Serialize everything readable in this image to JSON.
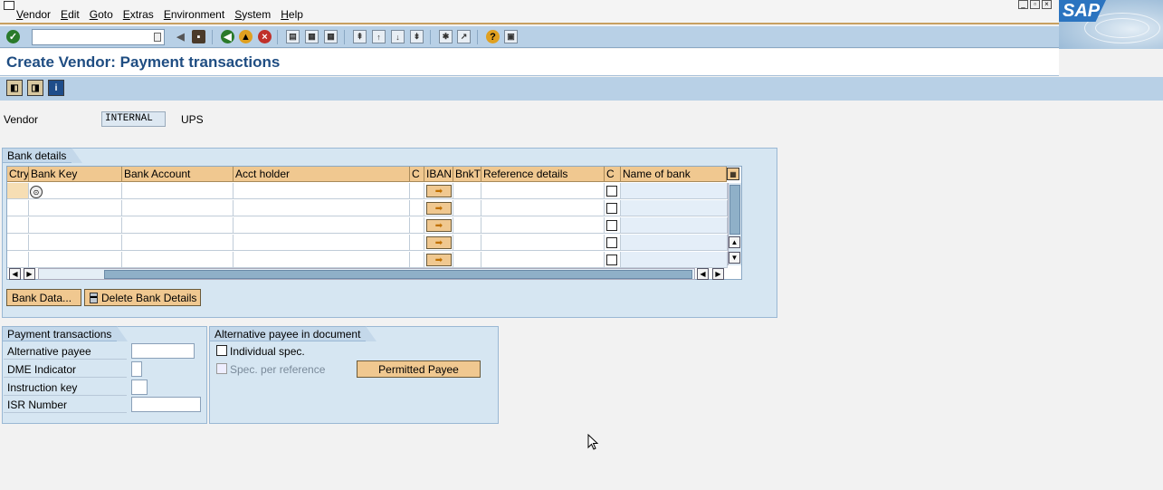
{
  "menu": {
    "items": [
      {
        "label": "Vendor",
        "u": "V",
        "rest": "endor"
      },
      {
        "label": "Edit",
        "u": "E",
        "rest": "dit"
      },
      {
        "label": "Goto",
        "u": "G",
        "rest": "oto"
      },
      {
        "label": "Extras",
        "u": "E",
        "rest": "xtras"
      },
      {
        "label": "Environment",
        "u": "E",
        "rest": "nvironment"
      },
      {
        "label": "System",
        "u": "S",
        "rest": "ystem"
      },
      {
        "label": "Help",
        "u": "H",
        "rest": "elp"
      }
    ]
  },
  "brand": {
    "logo_text": "SAP"
  },
  "command_field": {
    "value": ""
  },
  "title": "Create Vendor: Payment transactions",
  "vendor": {
    "label": "Vendor",
    "value": "INTERNAL",
    "name": "UPS"
  },
  "bank_details": {
    "title": "Bank details",
    "columns": [
      "Ctry",
      "Bank Key",
      "Bank Account",
      "Acct holder",
      "C",
      "IBAN",
      "BnkT",
      "Reference details",
      "C",
      "Name of bank"
    ],
    "rows": [
      [
        "",
        "",
        "",
        "",
        "",
        "",
        "",
        "",
        "",
        ""
      ],
      [
        "",
        "",
        "",
        "",
        "",
        "",
        "",
        "",
        "",
        ""
      ],
      [
        "",
        "",
        "",
        "",
        "",
        "",
        "",
        "",
        "",
        ""
      ],
      [
        "",
        "",
        "",
        "",
        "",
        "",
        "",
        "",
        "",
        ""
      ],
      [
        "",
        "",
        "",
        "",
        "",
        "",
        "",
        "",
        "",
        ""
      ]
    ],
    "buttons": {
      "bank_data": "Bank Data...",
      "delete": "Delete Bank Details"
    }
  },
  "payment_transactions": {
    "title": "Payment transactions",
    "fields": [
      {
        "label": "Alternative payee",
        "value": ""
      },
      {
        "label": "DME Indicator",
        "value": ""
      },
      {
        "label": "Instruction key",
        "value": ""
      },
      {
        "label": "ISR Number",
        "value": ""
      }
    ]
  },
  "alt_payee": {
    "title": "Alternative payee in document",
    "individual_spec": "Individual spec.",
    "spec_per_reference": "Spec. per reference",
    "permitted_payee": "Permitted Payee"
  },
  "colors": {
    "title": "#1f4d82",
    "toolbar": "#b8d0e6",
    "groupbox": "#d6e6f2",
    "header_cell": "#f0c890"
  }
}
